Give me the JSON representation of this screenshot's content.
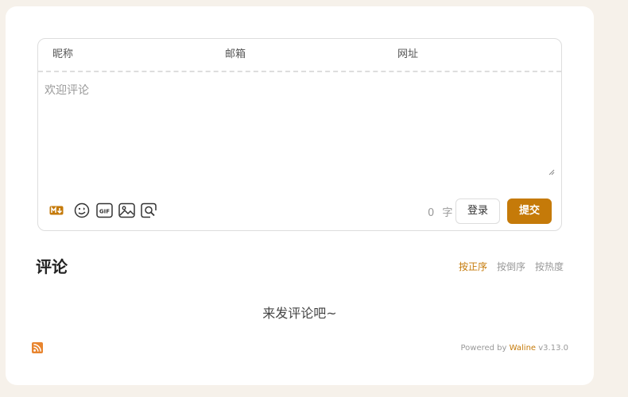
{
  "form": {
    "nickname_placeholder": "昵称",
    "email_placeholder": "邮箱",
    "website_placeholder": "网址",
    "comment_placeholder": "欢迎评论"
  },
  "toolbar": {
    "icons": [
      "markdown-icon",
      "emoji-icon",
      "gif-icon",
      "image-icon",
      "preview-icon"
    ],
    "word_count": "0",
    "word_unit": "字",
    "login_label": "登录",
    "submit_label": "提交"
  },
  "comments": {
    "title": "评论",
    "sort_options": [
      "按正序",
      "按倒序",
      "按热度"
    ],
    "active_sort": "按正序",
    "empty_text": "来发评论吧~"
  },
  "footer": {
    "powered_prefix": "Powered by",
    "powered_link": "Waline",
    "version": "v3.13.0"
  },
  "colors": {
    "accent": "#c57a09",
    "page_bg": "#f6f1ea",
    "rss": "#e8852f"
  }
}
